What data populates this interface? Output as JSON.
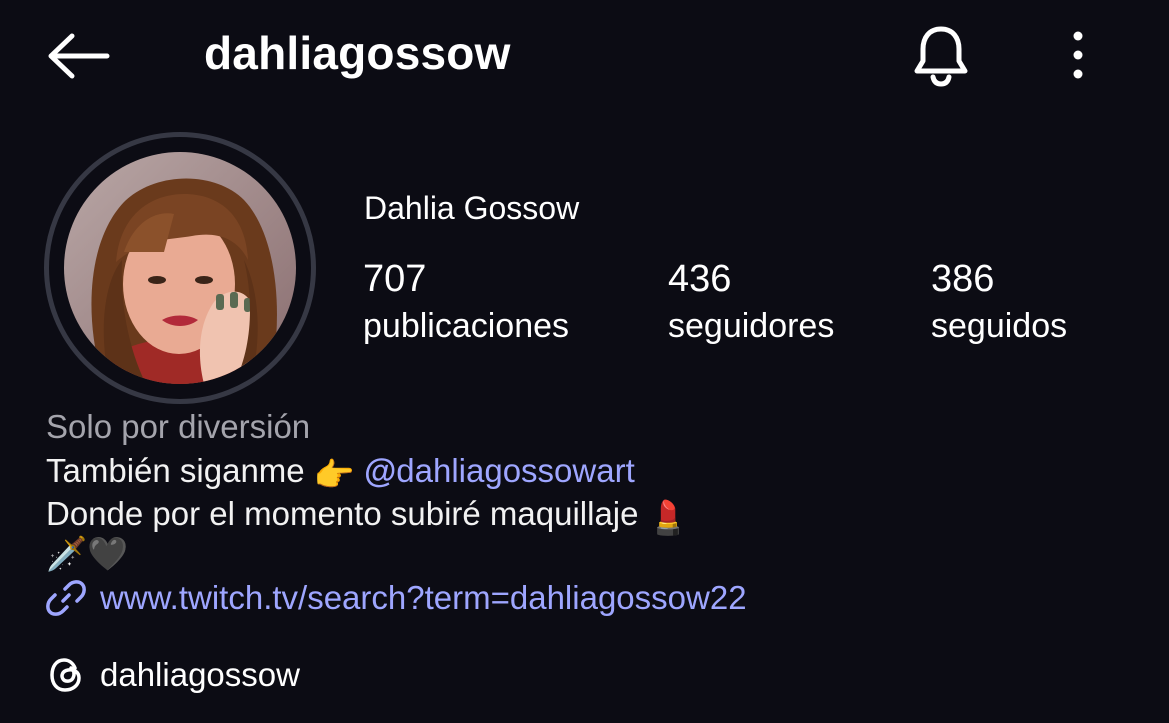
{
  "header": {
    "username": "dahliagossow",
    "back_icon": "arrow-left-icon",
    "bell_icon": "bell-icon",
    "more_icon": "more-vertical-icon"
  },
  "profile": {
    "display_name": "Dahlia Gossow",
    "avatar_icon": "profile-photo",
    "stats": {
      "posts_count": "707",
      "posts_label": "publicaciones",
      "followers_count": "436",
      "followers_label": "seguidores",
      "following_count": "386",
      "following_label": "seguidos"
    }
  },
  "bio": {
    "category": "Solo por diversión",
    "line1_text": "También siganme",
    "line1_emoji": "👉",
    "mention": "dahliagossowart",
    "line2_text": "Donde por el momento subiré maquillaje",
    "line2_emoji": "💄",
    "line3_emoji_1": "🗡️",
    "line3_emoji_2": "🖤",
    "link_icon": "link-icon",
    "link": "www.twitch.tv/search?term=dahliagossow22",
    "threads_icon": "threads-icon",
    "threads_username": "dahliagossow"
  },
  "colors": {
    "background": "#0c0c14",
    "link": "#9ea6ff",
    "muted_text": "#a4a4ac",
    "avatar_ring": "#363844"
  }
}
